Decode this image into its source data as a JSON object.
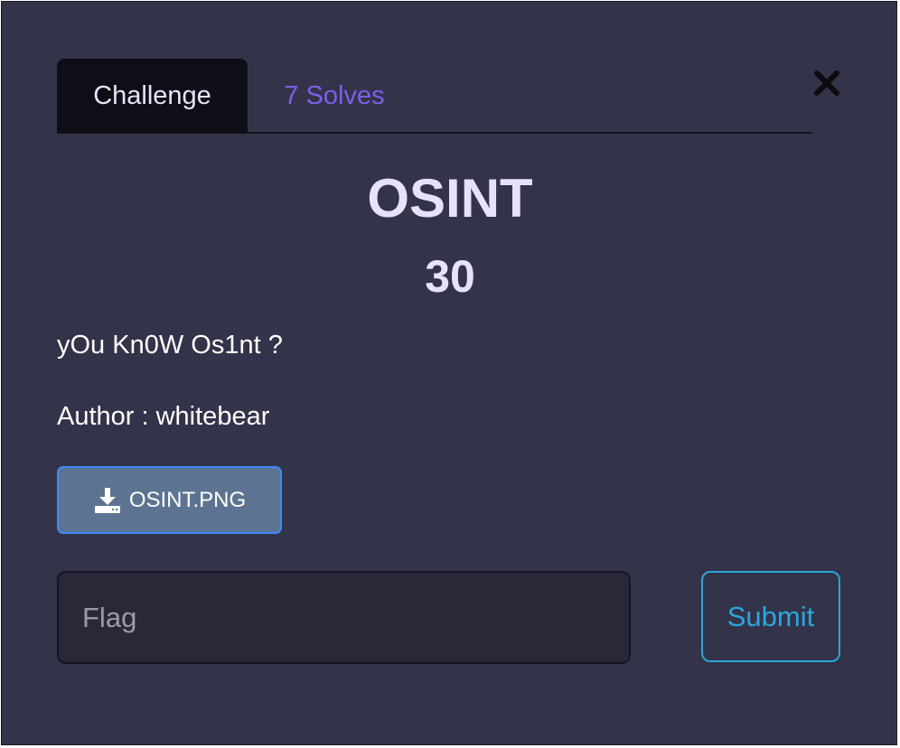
{
  "tabs": [
    {
      "label": "Challenge",
      "active": true
    },
    {
      "label": "7 Solves",
      "active": false
    }
  ],
  "challenge": {
    "name": "OSINT",
    "points": "30",
    "description": "yOu Kn0W Os1nt ?",
    "author": "Author : whitebear"
  },
  "file": {
    "label": "OSINT.PNG",
    "icon": "download-icon"
  },
  "flag": {
    "placeholder": "Flag",
    "value": ""
  },
  "submit": {
    "label": "Submit"
  },
  "close": {
    "icon": "close-icon"
  },
  "colors": {
    "background": "#33334a",
    "active_tab": "#0e0e17",
    "solves_tab": "#7d5fe8",
    "file_button": "#5c7491",
    "file_button_border": "#3d8af7",
    "submit_accent": "#2aa7dc"
  }
}
